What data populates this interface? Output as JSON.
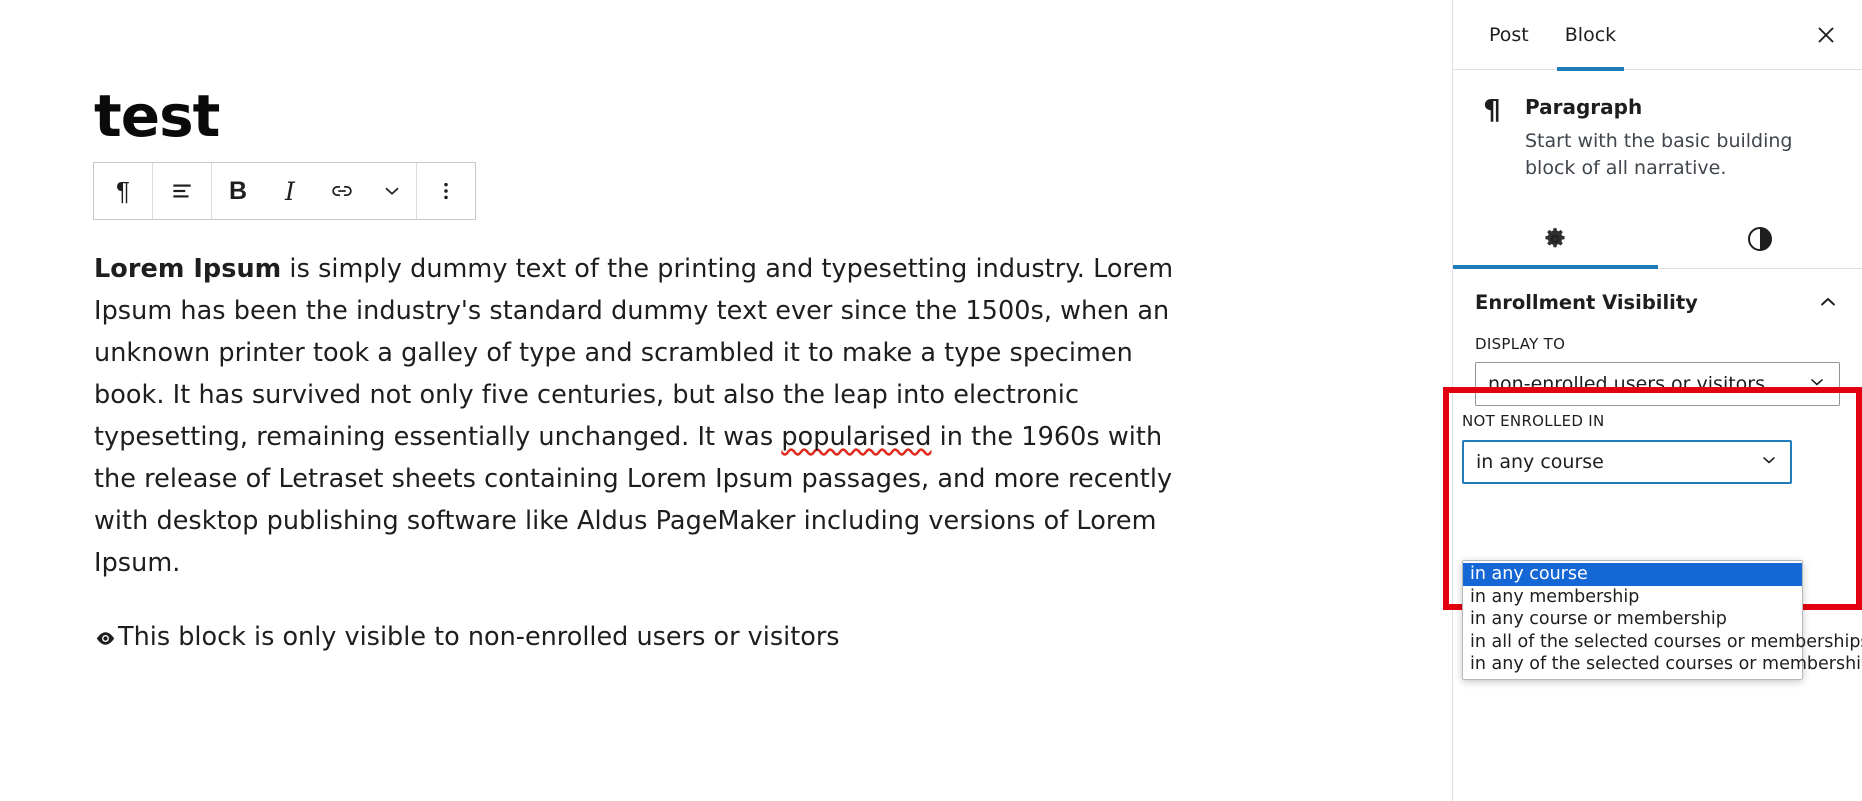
{
  "editor": {
    "post_title": "test",
    "toolbar": {
      "buttons": [
        {
          "name": "block-type-paragraph",
          "icon": "pilcrow-icon",
          "label": "¶"
        },
        {
          "name": "align-text",
          "icon": "align-left-icon",
          "label": ""
        },
        {
          "name": "bold",
          "icon": "bold-icon",
          "label": "B"
        },
        {
          "name": "italic",
          "icon": "italic-icon",
          "label": "I"
        },
        {
          "name": "link",
          "icon": "link-icon",
          "label": ""
        },
        {
          "name": "more-rich-text",
          "icon": "chevron-down-icon",
          "label": ""
        },
        {
          "name": "block-options",
          "icon": "vertical-ellipsis-icon",
          "label": ""
        }
      ]
    },
    "paragraph": {
      "lead": "Lorem Ipsum",
      "part_1": " is simply dummy text of the printing and typesetting industry. Lorem Ipsum has been the industry's standard dummy text ever since the 1500s, when an unknown printer took a galley of type and scrambled it to make a type specimen book. It has survived not only five centuries, but also the leap into electronic typesetting, remaining essentially unchanged. It was ",
      "misspelled_word": "popularised",
      "part_2": " in the 1960s with the release of Letraset sheets containing Lorem Ipsum passages, and more recently with desktop publishing software like Aldus PageMaker including versions of Lorem Ipsum."
    },
    "visibility_note": {
      "icon": "eye-icon",
      "text": "This block is only visible to non-enrolled users or visitors"
    }
  },
  "sidebar": {
    "tabs": [
      {
        "label": "Post",
        "active": false
      },
      {
        "label": "Block",
        "active": true
      }
    ],
    "close_label": "Close settings",
    "block_card": {
      "icon": "pilcrow-icon",
      "title": "Paragraph",
      "description": "Start with the basic building block of all narrative."
    },
    "panel_tabs": [
      {
        "name": "settings",
        "icon": "gear-icon",
        "active": true
      },
      {
        "name": "styles",
        "icon": "contrast-icon",
        "active": false
      }
    ],
    "panel": {
      "title": "Enrollment Visibility",
      "collapse_icon": "chevron-up-icon",
      "display_to": {
        "label": "DISPLAY TO",
        "value": "non-enrolled users or visitors"
      },
      "not_enrolled_in": {
        "label": "NOT ENROLLED IN",
        "value": "in any course",
        "open": true,
        "options": [
          "in any course",
          "in any membership",
          "in any course or membership",
          "in all of the selected courses or memberships",
          "in any of the selected courses or memberships"
        ],
        "selected_index": 0
      }
    }
  },
  "colors": {
    "accent": "#1f7cb8",
    "highlight_box": "#e3000f",
    "option_selected_bg": "#1667d6",
    "spellcheck_underline": "#e02b20",
    "text": "#1e1e1e"
  }
}
